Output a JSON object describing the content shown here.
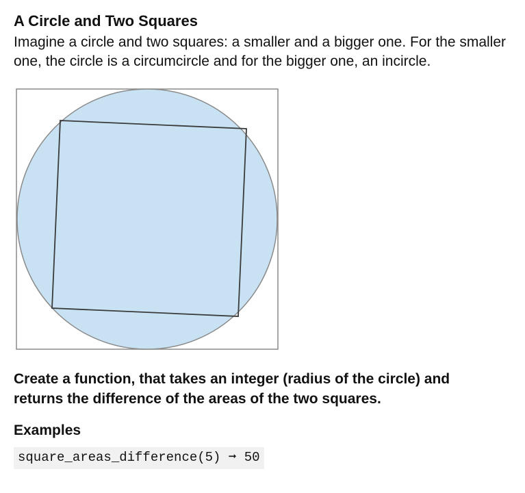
{
  "title": "A Circle and Two Squares",
  "intro": "Imagine a circle and two squares: a smaller and a bigger one. For the smaller one, the circle is a circumcircle and for the bigger one, an incircle.",
  "instruction": "Create a function, that takes an integer (radius of the circle) and returns the difference of the areas of the two squares.",
  "examples_heading": "Examples",
  "example_code": "square_areas_difference(5) ➞ 50",
  "figure": {
    "description": "A large square, an inscribed circle touching its sides, and a smaller square inscribed in the circle rotated slightly.",
    "colors": {
      "circle_fill": "#c8e2f4",
      "stroke": "#777777",
      "inner_stroke": "#444444"
    }
  }
}
